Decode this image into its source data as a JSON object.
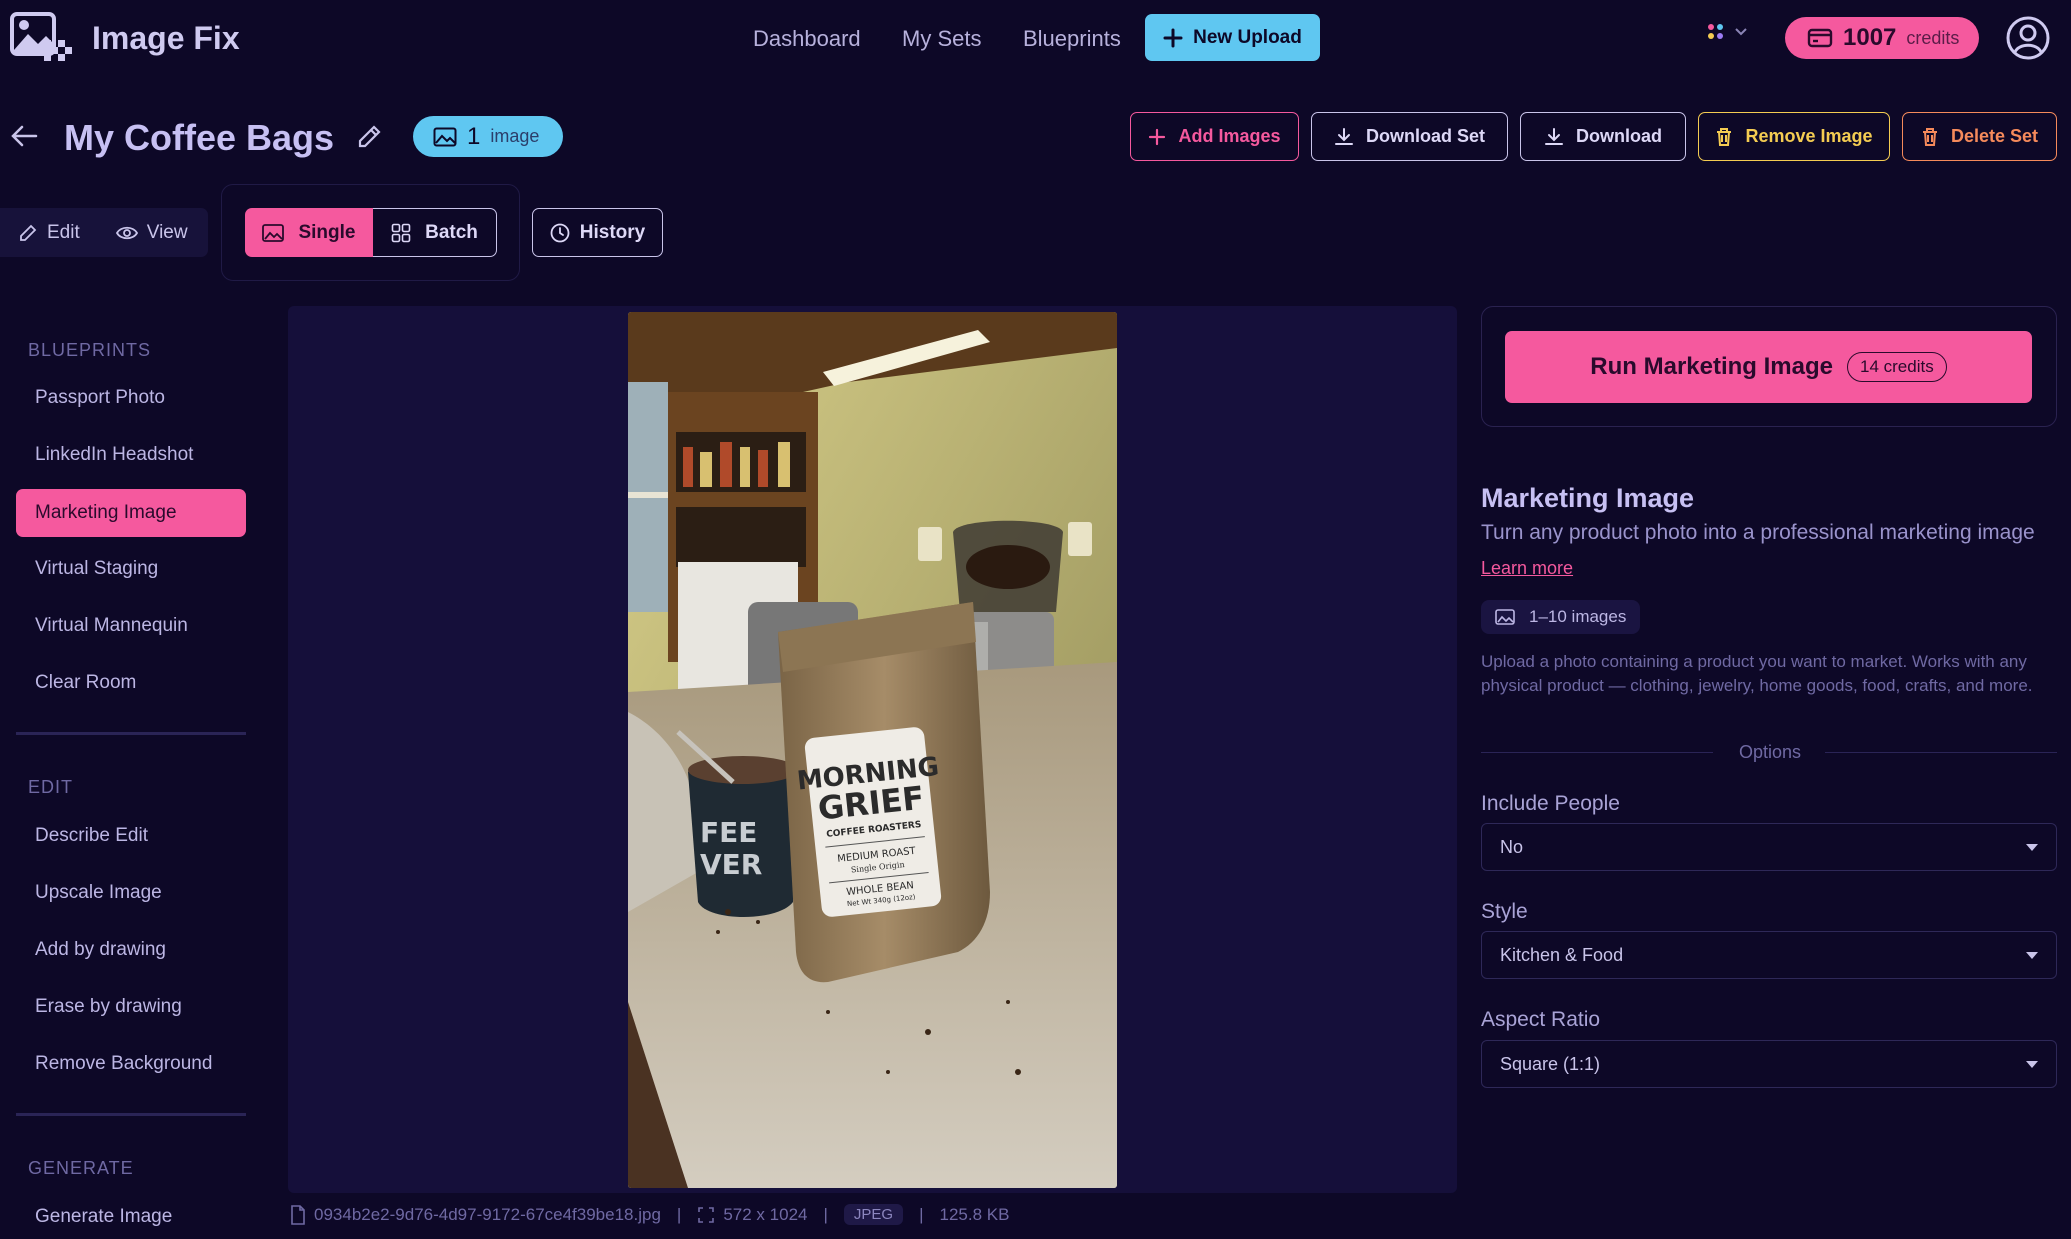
{
  "app": {
    "title": "Image Fix",
    "nav": [
      "Dashboard",
      "My Sets",
      "Blueprints"
    ],
    "new_upload": "New Upload",
    "credits_value": "1007",
    "credits_label": "credits"
  },
  "set": {
    "title": "My Coffee Bags",
    "image_count": "1",
    "image_unit": "image"
  },
  "actions": {
    "add_images": "Add Images",
    "download_set": "Download Set",
    "download": "Download",
    "remove_image": "Remove Image",
    "delete_set": "Delete Set"
  },
  "modes": {
    "edit": "Edit",
    "view": "View",
    "single": "Single",
    "batch": "Batch",
    "history": "History"
  },
  "sidebar": {
    "blueprints_heading": "BLUEPRINTS",
    "blueprints": [
      "Passport Photo",
      "LinkedIn Headshot",
      "Marketing Image",
      "Virtual Staging",
      "Virtual Mannequin",
      "Clear Room"
    ],
    "active_blueprint": "Marketing Image",
    "edit_heading": "EDIT",
    "edit_items": [
      "Describe Edit",
      "Upscale Image",
      "Add by drawing",
      "Erase by drawing",
      "Remove Background"
    ],
    "generate_heading": "GENERATE",
    "generate_items": [
      "Generate Image"
    ]
  },
  "file": {
    "name": "0934b2e2-9d76-4d97-9172-67ce4f39be18.jpg",
    "dimensions": "572 x 1024",
    "format": "JPEG",
    "size": "125.8 KB"
  },
  "panel": {
    "run_label": "Run Marketing Image",
    "run_cost": "14 credits",
    "blueprint_title": "Marketing Image",
    "blueprint_subtitle": "Turn any product photo into a professional marketing image",
    "learn_more": "Learn more",
    "image_range": "1–10 images",
    "description": "Upload a photo containing a product you want to market. Works with any physical product — clothing, jewelry, home goods, food, crafts, and more.",
    "options_label": "Options",
    "include_people_label": "Include People",
    "include_people_value": "No",
    "style_label": "Style",
    "style_value": "Kitchen & Food",
    "aspect_label": "Aspect Ratio",
    "aspect_value": "Square (1:1)"
  },
  "photo": {
    "bag_line1": "MORNING",
    "bag_line2": "GRIEF",
    "bag_line3": "COFFEE ROASTERS",
    "bag_line4": "MEDIUM ROAST",
    "bag_line5": "Single Origin",
    "bag_line6": "WHOLE BEAN",
    "bag_line7": "Net Wt 340g (12oz)",
    "mug_text": "FEE\nVER"
  },
  "colors": {
    "background": "#0d0827",
    "accent_pink": "#f5599e",
    "accent_blue": "#5fc7f1",
    "warning_yellow": "#f4cc52",
    "danger_orange": "#f58a5b"
  },
  "icons": [
    "logo-icon",
    "plus-icon",
    "palette-icon",
    "chevron-down-icon",
    "wallet-icon",
    "user-icon",
    "arrow-left-icon",
    "pencil-icon",
    "image-icon",
    "download-icon",
    "trash-icon",
    "eye-icon",
    "grid-icon",
    "clock-icon",
    "file-icon",
    "expand-icon",
    "caret-down-icon"
  ]
}
